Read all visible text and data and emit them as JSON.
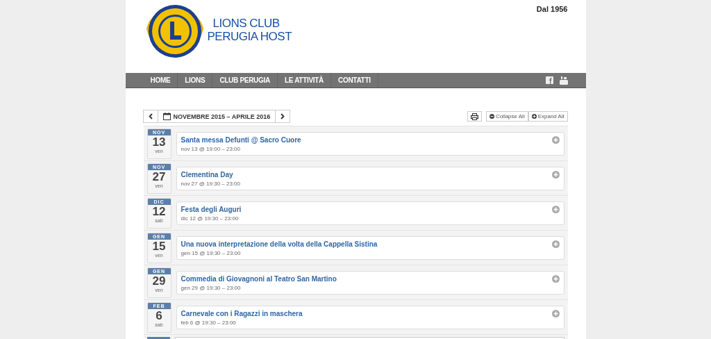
{
  "header": {
    "title_lines": [
      "LIONS CLUB",
      "PERUGIA HOST"
    ],
    "since": "Dal 1956"
  },
  "nav": {
    "items": [
      {
        "label": "HOME"
      },
      {
        "label": "LIONS"
      },
      {
        "label": "CLUB PERUGIA"
      },
      {
        "label": "LE ATTIVITÀ"
      },
      {
        "label": "CONTATTI"
      }
    ]
  },
  "calendar": {
    "range": "NOVEMBRE 2015 – APRILE 2016",
    "collapse": "Collapse All",
    "expand": "Expand All"
  },
  "events": [
    {
      "month": "NOV",
      "day": "13",
      "weekday": "ven",
      "title": "Santa messa Defunti @ Sacro Cuore",
      "time": "nov 13 @ 19:00 – 23:00"
    },
    {
      "month": "NOV",
      "day": "27",
      "weekday": "ven",
      "title": "Clementina Day",
      "time": "nov 27 @ 19:30 – 23:00"
    },
    {
      "month": "DIC",
      "day": "12",
      "weekday": "sab",
      "title": "Festa degli Auguri",
      "time": "dic 12 @ 19:30 – 23:00"
    },
    {
      "month": "GEN",
      "day": "15",
      "weekday": "ven",
      "title": "Una nuova interpretazione della volta della Cappella Sistina",
      "time": "gen 15 @ 19:30 – 23:00"
    },
    {
      "month": "GEN",
      "day": "29",
      "weekday": "ven",
      "title": "Commedia di Giovagnoni al Teatro San Martino",
      "time": "gen 29 @ 19:30 – 23:00"
    },
    {
      "month": "FEB",
      "day": "6",
      "weekday": "sab",
      "title": "Carnevale con i Ragazzi in maschera",
      "time": "feb 6 @ 19:30 – 23:00"
    }
  ]
}
